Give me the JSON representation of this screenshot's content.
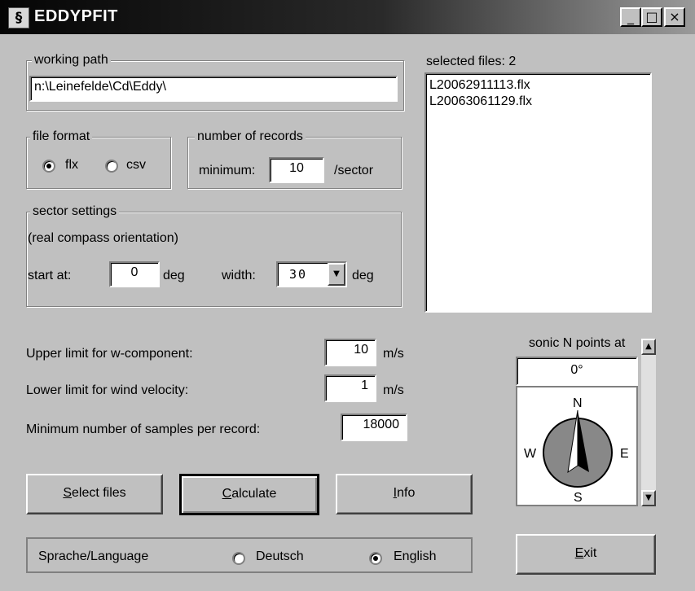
{
  "window": {
    "title": "EDDYPFIT",
    "icon": "app-logo-icon",
    "controls": {
      "minimize": "_",
      "maximize": "□",
      "close": "×"
    }
  },
  "working_path": {
    "legend": "working path",
    "value": "n:\\Leinefelde\\Cd\\Eddy\\"
  },
  "selected_files": {
    "label": "selected files: 2",
    "files": [
      "L20062911113.flx",
      "L20063061129.flx"
    ]
  },
  "file_format": {
    "legend": "file format",
    "options": [
      {
        "label": "flx",
        "checked": true
      },
      {
        "label": "csv",
        "checked": false
      }
    ]
  },
  "number_of_records": {
    "legend": "number of records",
    "min_label": "minimum:",
    "value": "10",
    "unit": "/sector"
  },
  "sector_settings": {
    "legend": "sector settings",
    "note": "(real compass orientation)",
    "start_label": "start at:",
    "start_value": "0",
    "start_unit": "deg",
    "width_label": "width:",
    "width_value": "30",
    "width_unit": "deg"
  },
  "limits": {
    "w_label": "Upper limit for w-component:",
    "w_value": "10",
    "w_unit": "m/s",
    "v_label": "Lower limit for wind velocity:",
    "v_value": "1",
    "v_unit": "m/s",
    "samples_label": "Minimum number of samples per record:",
    "samples_value": "18000"
  },
  "buttons": {
    "select_files": {
      "key": "S",
      "rest": "elect files"
    },
    "calculate": {
      "key": "C",
      "rest": "alculate"
    },
    "info": {
      "key": "I",
      "rest": "nfo"
    },
    "exit": {
      "key": "E",
      "rest": "xit"
    }
  },
  "sonic": {
    "label": "sonic N points at",
    "value": "0°",
    "compass": {
      "n": "N",
      "e": "E",
      "s": "S",
      "w": "W"
    },
    "scroll_position": 0
  },
  "language": {
    "label": "Sprache/Language",
    "options": [
      {
        "label": "Deutsch",
        "checked": false
      },
      {
        "label": "English",
        "checked": true
      }
    ]
  }
}
